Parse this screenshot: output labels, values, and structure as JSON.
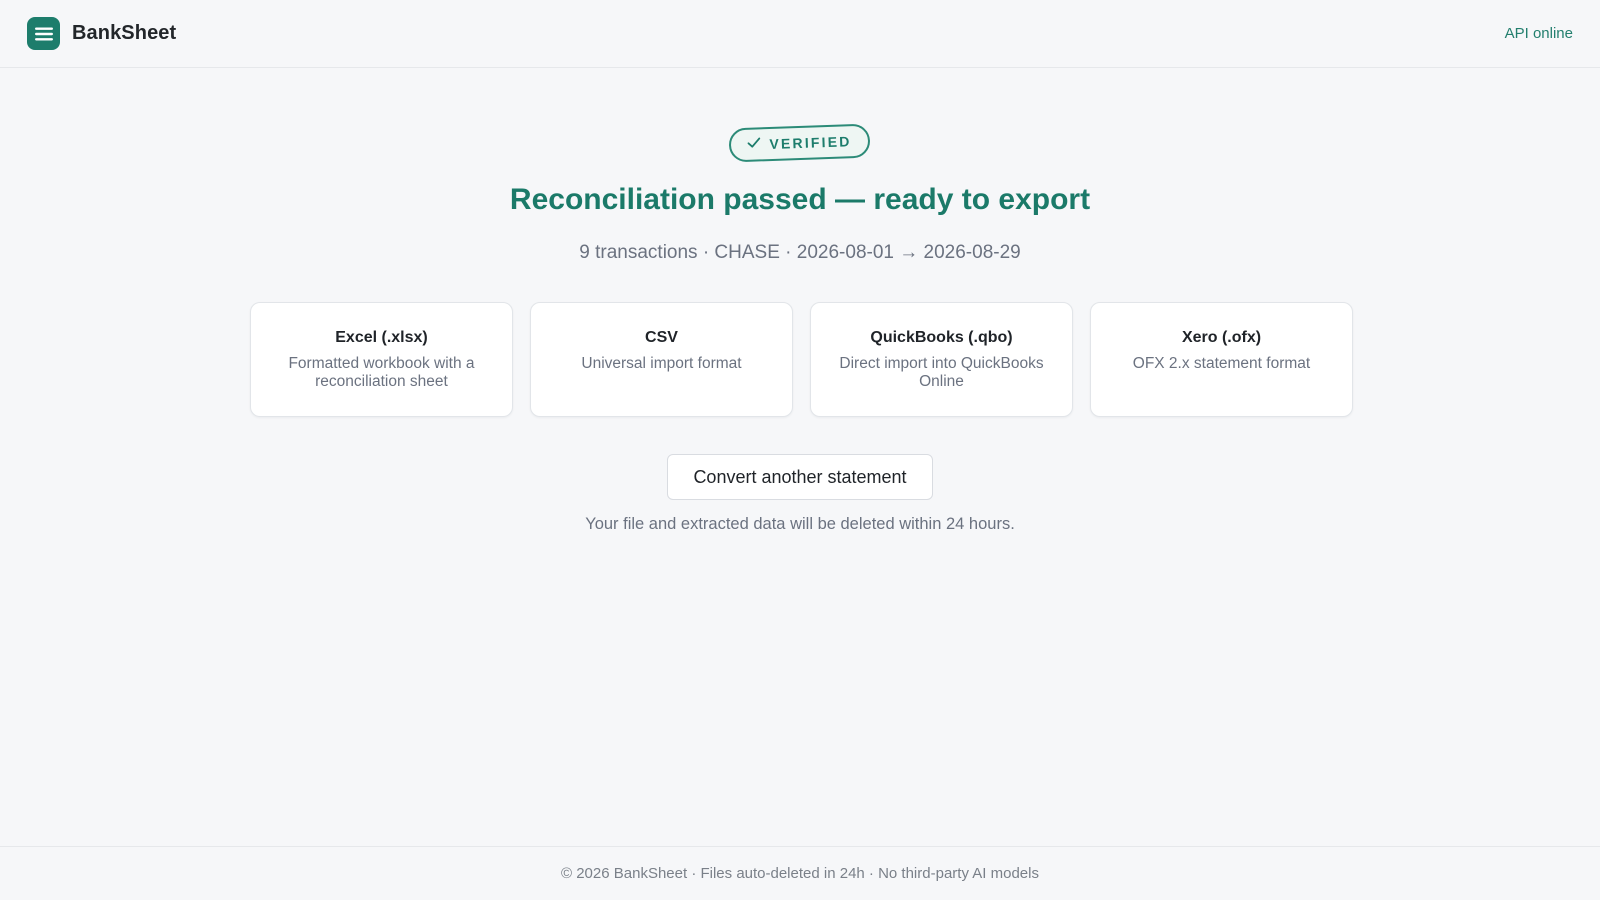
{
  "app": {
    "name": "BankSheet",
    "logo_icon": "list-lines-icon",
    "brand_color": "#1d7d6c"
  },
  "header": {
    "api_status": "API online",
    "api_status_color": "#237f6e"
  },
  "result": {
    "badge_label": "VERIFIED",
    "badge_icon": "check-icon",
    "headline": "Reconciliation passed — ready to export",
    "summary": "9 transactions · CHASE · 2026-08-01 → 2026-08-29"
  },
  "formats": [
    {
      "name": "Excel (.xlsx)",
      "description": "Formatted workbook with a reconciliation sheet"
    },
    {
      "name": "CSV",
      "description": "Universal import format"
    },
    {
      "name": "QuickBooks (.qbo)",
      "description": "Direct import into QuickBooks Online"
    },
    {
      "name": "Xero (.ofx)",
      "description": "OFX 2.x statement format"
    }
  ],
  "actions": {
    "convert_another": "Convert another statement"
  },
  "retention_note": "Your file and extracted data will be deleted within 24 hours.",
  "footer": {
    "text": "© 2026 BankSheet · Files auto-deleted in 24h · No third-party AI models"
  }
}
